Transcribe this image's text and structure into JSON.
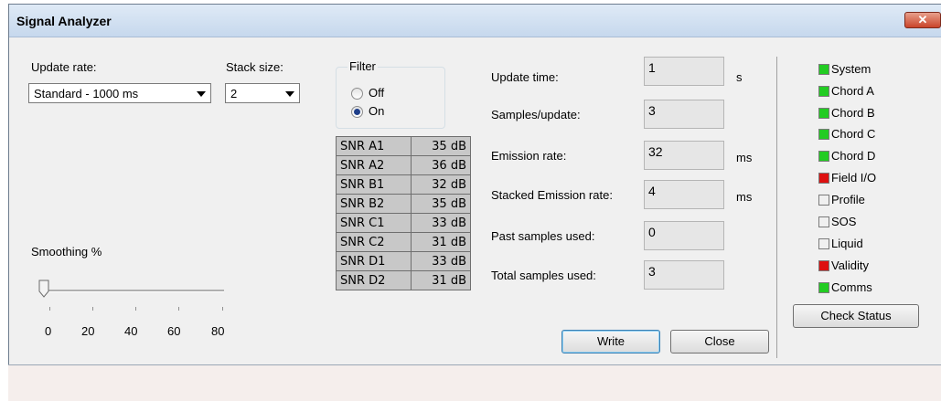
{
  "window": {
    "title": "Signal Analyzer",
    "close_glyph": "✕"
  },
  "update_rate": {
    "label": "Update rate:",
    "value": "Standard - 1000 ms"
  },
  "stack_size": {
    "label": "Stack size:",
    "value": "2"
  },
  "filter": {
    "label": "Filter",
    "options": [
      "Off",
      "On"
    ],
    "selected": "On"
  },
  "snr_table": [
    {
      "name": "SNR A1",
      "value": "35 dB"
    },
    {
      "name": "SNR A2",
      "value": "36 dB"
    },
    {
      "name": "SNR B1",
      "value": "32 dB"
    },
    {
      "name": "SNR B2",
      "value": "35 dB"
    },
    {
      "name": "SNR C1",
      "value": "33 dB"
    },
    {
      "name": "SNR C2",
      "value": "31 dB"
    },
    {
      "name": "SNR D1",
      "value": "33 dB"
    },
    {
      "name": "SNR D2",
      "value": "31 dB"
    }
  ],
  "smoothing": {
    "label": "Smoothing %",
    "value": 0,
    "ticks": [
      "0",
      "20",
      "40",
      "60",
      "80"
    ]
  },
  "fields": [
    {
      "label": "Update time:",
      "value": "1",
      "unit": "s"
    },
    {
      "label": "Samples/update:",
      "value": "3",
      "unit": ""
    },
    {
      "label": "Emission rate:",
      "value": "32",
      "unit": "ms"
    },
    {
      "label": "Stacked Emission rate:",
      "value": "4",
      "unit": "ms"
    },
    {
      "label": "Past samples used:",
      "value": "0",
      "unit": ""
    },
    {
      "label": "Total samples used:",
      "value": "3",
      "unit": ""
    }
  ],
  "buttons": {
    "write": "Write",
    "close": "Close",
    "check_status": "Check Status"
  },
  "status_items": [
    {
      "label": "System",
      "color": "#22cc22"
    },
    {
      "label": "Chord A",
      "color": "#22cc22"
    },
    {
      "label": "Chord B",
      "color": "#22cc22"
    },
    {
      "label": "Chord C",
      "color": "#22cc22"
    },
    {
      "label": "Chord D",
      "color": "#22cc22"
    },
    {
      "label": "Field I/O",
      "color": "#dd1111"
    },
    {
      "label": "Profile",
      "color": "#f0f0f0"
    },
    {
      "label": "SOS",
      "color": "#f0f0f0"
    },
    {
      "label": "Liquid",
      "color": "#f0f0f0"
    },
    {
      "label": "Validity",
      "color": "#dd1111"
    },
    {
      "label": "Comms",
      "color": "#22cc22"
    }
  ]
}
